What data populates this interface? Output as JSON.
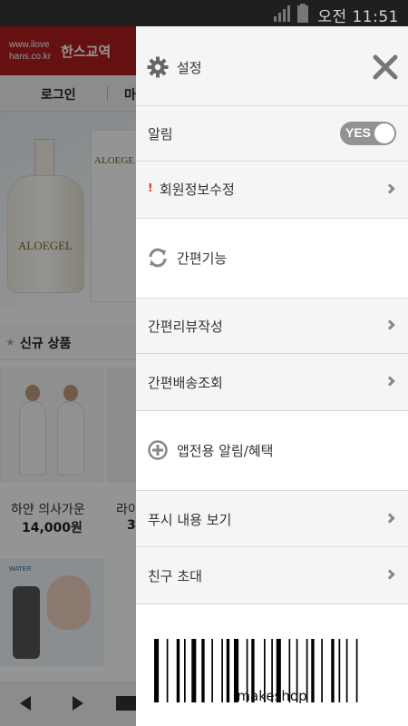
{
  "status_bar": {
    "time": "오전 11:51"
  },
  "background_page": {
    "logo_url_line1": "www.ilove",
    "logo_url_line2": "hans.co.kr",
    "logo_name": "한스교역",
    "nav_login": "로그인",
    "nav_second": "마",
    "banner_label": "ALOEGEL",
    "banner_box_label": "ALOEGE",
    "section_title": "신규 상품",
    "products": [
      {
        "name": "하얀 의사가운",
        "price": "14,000원"
      },
      {
        "name": "라이",
        "price": "3"
      }
    ],
    "ad_text": "WATER"
  },
  "drawer": {
    "settings_label": "설정",
    "notification": {
      "label": "알림",
      "toggle_text": "YES",
      "toggle_state": true
    },
    "member_edit": {
      "marker": "!",
      "label": "회원정보수정"
    },
    "quick_section_label": "간편기능",
    "quick_items": [
      "간편리뷰작성",
      "간편배송조회"
    ],
    "app_alert_section_label": "앱전용 알림/혜택",
    "app_items": [
      "푸시 내용 보기",
      "친구 초대"
    ],
    "barcode_caption": "makeshop"
  },
  "colors": {
    "header_red": "#b01e1e",
    "toggle_gray": "#929292",
    "row_gray": "#f5f5f5"
  }
}
